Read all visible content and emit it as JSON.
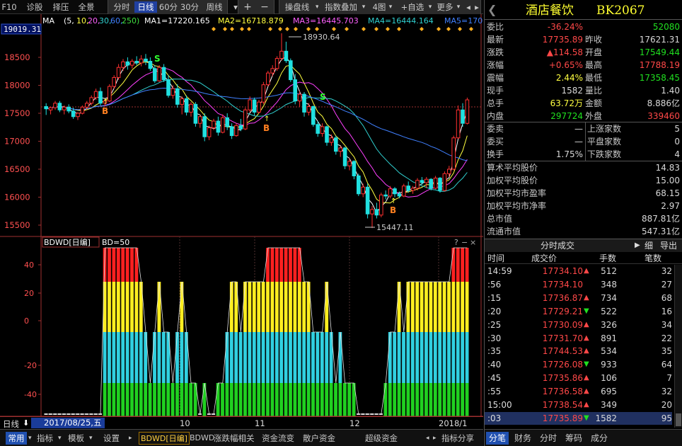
{
  "toolbar": {
    "f10": "F10",
    "zhenggu": "诊股",
    "zeya": "择压",
    "quanjing": "全景",
    "fenshi": "分时",
    "rixian": "日线",
    "m60": "60分",
    "m30": "30分",
    "zhouxian": "周线",
    "plus": "+",
    "minus": "−",
    "caopan": "操盘线",
    "zhishu": "指数叠加",
    "situ": "4图",
    "zixuan": "+自选",
    "more": "更多"
  },
  "price_axis": {
    "current": "19019.31",
    "ticks": [
      "18500",
      "18000",
      "17500",
      "17000",
      "16500",
      "16000",
      "15500"
    ]
  },
  "ma_legend": {
    "prefix": "MA",
    "params": "(5,",
    "p10": "10,",
    "p20": "20,",
    "p30": "30,",
    "p60": "60,",
    "p250": "250)",
    "ma1": "MA1=17220.165",
    "ma2": "MA2=16718.879",
    "ma3": "MA3=16445.703",
    "ma4": "MA4=16444.164",
    "ma5": "MA5=170"
  },
  "annotations": {
    "high": "18930.64",
    "low": "15447.11",
    "b": "B",
    "s": "S"
  },
  "indicator": {
    "name": "BDWD[日编]",
    "param": "BD=50",
    "ticks": [
      "40",
      "20",
      "0",
      "-20",
      "-40"
    ]
  },
  "date_bar": {
    "label": "日线",
    "date": "2017/08/25,五",
    "months": [
      "10",
      "11",
      "12",
      "2018/1"
    ]
  },
  "bottom_tabs": {
    "changyong": "常用",
    "zhibiao": "指标",
    "moban": "模板",
    "shezhi": "设置",
    "bdwd": "BDWD[日编]",
    "bdwd2": "BDWD",
    "zhangdie": "涨跌幅相关",
    "zijin": "资金流变",
    "sanhu": "散户资金",
    "chaoji": "超级资金",
    "zhibiaofx": "指标分享"
  },
  "stock": {
    "name": "酒店餐饮",
    "code": "BK2067"
  },
  "quote": [
    {
      "l": "委比",
      "v": "-36.24%",
      "vc": "red",
      "l2": "",
      "v2": "52080",
      "v2c": "grn"
    },
    {
      "l": "最新",
      "v": "17735.89",
      "vc": "red",
      "l2": "昨收",
      "v2": "17621.31",
      "v2c": "wht"
    },
    {
      "l": "涨跌",
      "v": "▲114.58",
      "vc": "red",
      "l2": "开盘",
      "v2": "17549.44",
      "v2c": "grn"
    },
    {
      "l": "涨幅",
      "v": "+0.65%",
      "vc": "red",
      "l2": "最高",
      "v2": "17788.19",
      "v2c": "red"
    },
    {
      "l": "震幅",
      "v": "2.44%",
      "vc": "yel",
      "l2": "最低",
      "v2": "17358.45",
      "v2c": "grn"
    },
    {
      "l": "现手",
      "v": "1582",
      "vc": "wht",
      "l2": "量比",
      "v2": "1.40",
      "v2c": "wht"
    },
    {
      "l": "总手",
      "v": "63.72万",
      "vc": "yel",
      "l2": "金额",
      "v2": "8.886亿",
      "v2c": "wht"
    },
    {
      "l": "内盘",
      "v": "297724",
      "vc": "grn",
      "l2": "外盘",
      "v2": "339460",
      "v2c": "red"
    }
  ],
  "orders": [
    {
      "l": "委卖",
      "v": "—",
      "l2": "上涨家数",
      "v2": "5"
    },
    {
      "l": "委买",
      "v": "—",
      "l2": "平盘家数",
      "v2": "0"
    },
    {
      "l": "换手",
      "v": "1.75%",
      "l2": "下跌家数",
      "v2": "4"
    }
  ],
  "stats": [
    {
      "l": "算术平均股价",
      "v": "14.83"
    },
    {
      "l": "加权平均股价",
      "v": "15.00"
    },
    {
      "l": "加权平均市盈率",
      "v": "68.15"
    },
    {
      "l": "加权平均市净率",
      "v": "2.97"
    },
    {
      "l": "总市值",
      "v": "887.81亿"
    },
    {
      "l": "流通市值",
      "v": "547.31亿"
    }
  ],
  "ticks_panel": {
    "title": "分时成交",
    "xi": "细",
    "daochu": "导出",
    "h_time": "时间",
    "h_price": "成交价",
    "h_vol": "手数",
    "h_cnt": "笔数"
  },
  "ticks": [
    {
      "t": "14:59",
      "p": "17734.10",
      "a": "▲",
      "ac": "red",
      "pc": "red",
      "h": "512",
      "n": "32"
    },
    {
      "t": ":56",
      "p": "17734.10",
      "a": "",
      "ac": "red",
      "pc": "red",
      "h": "348",
      "n": "27"
    },
    {
      "t": ":15",
      "p": "17736.87",
      "a": "▲",
      "ac": "red",
      "pc": "red",
      "h": "734",
      "n": "68"
    },
    {
      "t": ":20",
      "p": "17729.21",
      "a": "▼",
      "ac": "grn",
      "pc": "red",
      "h": "522",
      "n": "16"
    },
    {
      "t": ":25",
      "p": "17730.09",
      "a": "▲",
      "ac": "red",
      "pc": "red",
      "h": "326",
      "n": "34"
    },
    {
      "t": ":30",
      "p": "17731.70",
      "a": "▲",
      "ac": "red",
      "pc": "red",
      "h": "891",
      "n": "22"
    },
    {
      "t": ":35",
      "p": "17744.53",
      "a": "▲",
      "ac": "red",
      "pc": "red",
      "h": "534",
      "n": "35"
    },
    {
      "t": ":40",
      "p": "17726.08",
      "a": "▼",
      "ac": "grn",
      "pc": "red",
      "h": "933",
      "n": "64"
    },
    {
      "t": ":45",
      "p": "17735.86",
      "a": "▲",
      "ac": "red",
      "pc": "red",
      "h": "106",
      "n": "7"
    },
    {
      "t": ":55",
      "p": "17736.58",
      "a": "▲",
      "ac": "red",
      "pc": "red",
      "h": "695",
      "n": "32"
    },
    {
      "t": "15:00",
      "p": "17738.54",
      "a": "▲",
      "ac": "red",
      "pc": "red",
      "h": "349",
      "n": "20"
    },
    {
      "t": ":03",
      "p": "17735.89",
      "a": "▼",
      "ac": "grn",
      "pc": "red",
      "h": "1582",
      "n": "95"
    }
  ],
  "right_tabs": {
    "fenbi": "分笔",
    "caiwu": "财务",
    "fenshi": "分时",
    "shouma": "筹码",
    "chengfen": "成分"
  },
  "colors": {
    "up": "#ff3030",
    "down": "#20e0e0",
    "ma1": "#ffffff",
    "ma2": "#ffff30",
    "ma3": "#ff40ff",
    "ma4": "#30d0d0",
    "ma5": "#4080ff"
  },
  "chart_data": {
    "type": "candlestick",
    "ylim": [
      15300,
      19019.31
    ],
    "candles": [
      [
        17620,
        17680,
        17470,
        17580
      ],
      [
        17560,
        17620,
        17480,
        17600
      ],
      [
        17600,
        17720,
        17560,
        17680
      ],
      [
        17680,
        17720,
        17520,
        17560
      ],
      [
        17560,
        17640,
        17480,
        17610
      ],
      [
        17610,
        17660,
        17500,
        17540
      ],
      [
        17540,
        17600,
        17400,
        17440
      ],
      [
        17440,
        17520,
        17380,
        17500
      ],
      [
        17500,
        17640,
        17480,
        17610
      ],
      [
        17610,
        17720,
        17560,
        17680
      ],
      [
        17680,
        17820,
        17640,
        17780
      ],
      [
        17780,
        17940,
        17740,
        17890
      ],
      [
        17890,
        17960,
        17640,
        17680
      ],
      [
        17680,
        17760,
        17620,
        17720
      ],
      [
        17720,
        18020,
        17700,
        17980
      ],
      [
        17980,
        18180,
        17940,
        18140
      ],
      [
        18140,
        18380,
        18100,
        18320
      ],
      [
        18320,
        18470,
        18260,
        18420
      ],
      [
        18420,
        18500,
        18280,
        18360
      ],
      [
        18360,
        18470,
        18300,
        18430
      ],
      [
        18430,
        18520,
        18360,
        18400
      ],
      [
        18400,
        18540,
        18340,
        18470
      ],
      [
        18470,
        18560,
        18360,
        18430
      ],
      [
        18430,
        18500,
        18260,
        18300
      ],
      [
        18300,
        18360,
        18040,
        18080
      ],
      [
        18080,
        18360,
        18060,
        18320
      ],
      [
        18320,
        18380,
        18060,
        18100
      ],
      [
        18100,
        18180,
        17780,
        17820
      ],
      [
        17820,
        18000,
        17760,
        17940
      ],
      [
        17940,
        18020,
        17600,
        17660
      ],
      [
        17660,
        17800,
        17480,
        17760
      ],
      [
        17760,
        17820,
        17460,
        17520
      ],
      [
        17520,
        17700,
        17440,
        17660
      ],
      [
        17660,
        17700,
        17260,
        17320
      ],
      [
        17320,
        17480,
        17240,
        17440
      ],
      [
        17440,
        17500,
        17000,
        17080
      ],
      [
        17080,
        17280,
        17020,
        17240
      ],
      [
        17240,
        17400,
        17200,
        17360
      ],
      [
        17360,
        17440,
        17100,
        17160
      ],
      [
        17160,
        17480,
        17140,
        17420
      ],
      [
        17420,
        17500,
        17200,
        17260
      ],
      [
        17260,
        17320,
        17040,
        17100
      ],
      [
        17100,
        17320,
        17080,
        17280
      ],
      [
        17280,
        17400,
        17180,
        17220
      ],
      [
        17220,
        17600,
        17200,
        17560
      ],
      [
        17560,
        17800,
        17520,
        17740
      ],
      [
        17740,
        17780,
        17460,
        17520
      ],
      [
        17520,
        17740,
        17500,
        17700
      ],
      [
        17700,
        18060,
        17660,
        18010
      ],
      [
        18010,
        18260,
        17980,
        18220
      ],
      [
        18220,
        18360,
        18160,
        18300
      ],
      [
        18300,
        18520,
        18260,
        18480
      ],
      [
        18480,
        18930,
        18440,
        18610
      ],
      [
        18610,
        18780,
        18400,
        18440
      ],
      [
        18440,
        18480,
        18060,
        18100
      ],
      [
        18100,
        18200,
        17660,
        17720
      ],
      [
        17720,
        17900,
        17620,
        17840
      ],
      [
        17840,
        17880,
        17440,
        17520
      ],
      [
        17520,
        17680,
        17460,
        17620
      ],
      [
        17620,
        17640,
        17260,
        17300
      ],
      [
        17300,
        17360,
        17080,
        17140
      ],
      [
        17140,
        17320,
        17080,
        17260
      ],
      [
        17260,
        17280,
        16920,
        16980
      ],
      [
        16980,
        17120,
        16920,
        17060
      ],
      [
        17060,
        17100,
        16760,
        16820
      ],
      [
        16820,
        16920,
        16720,
        16880
      ],
      [
        16880,
        16900,
        16500,
        16560
      ],
      [
        16560,
        16700,
        16480,
        16640
      ],
      [
        16640,
        16660,
        16320,
        16380
      ],
      [
        16380,
        16420,
        16020,
        16060
      ],
      [
        16060,
        16240,
        16000,
        16180
      ],
      [
        16180,
        16240,
        15620,
        15700
      ],
      [
        15700,
        15840,
        15447,
        15780
      ],
      [
        15780,
        15900,
        15620,
        15680
      ],
      [
        15680,
        16080,
        15640,
        16040
      ],
      [
        16040,
        16120,
        15960,
        16020
      ],
      [
        16020,
        16200,
        15980,
        16150
      ],
      [
        16150,
        16180,
        16000,
        16060
      ],
      [
        16060,
        16100,
        15980,
        16020
      ],
      [
        16020,
        16240,
        16000,
        16200
      ],
      [
        16200,
        16280,
        16080,
        16120
      ],
      [
        16120,
        16200,
        16060,
        16160
      ],
      [
        16160,
        16340,
        16120,
        16300
      ],
      [
        16300,
        16360,
        16220,
        16260
      ],
      [
        16260,
        16360,
        16160,
        16320
      ],
      [
        16320,
        16340,
        16120,
        16160
      ],
      [
        16160,
        16380,
        16140,
        16340
      ],
      [
        16340,
        16360,
        16080,
        16120
      ],
      [
        16120,
        16460,
        16100,
        16420
      ],
      [
        16420,
        16560,
        16360,
        16500
      ],
      [
        16500,
        17100,
        16480,
        17060
      ],
      [
        17060,
        17640,
        17040,
        17560
      ],
      [
        17560,
        17680,
        17260,
        17320
      ],
      [
        17320,
        17780,
        17300,
        17740
      ]
    ]
  }
}
